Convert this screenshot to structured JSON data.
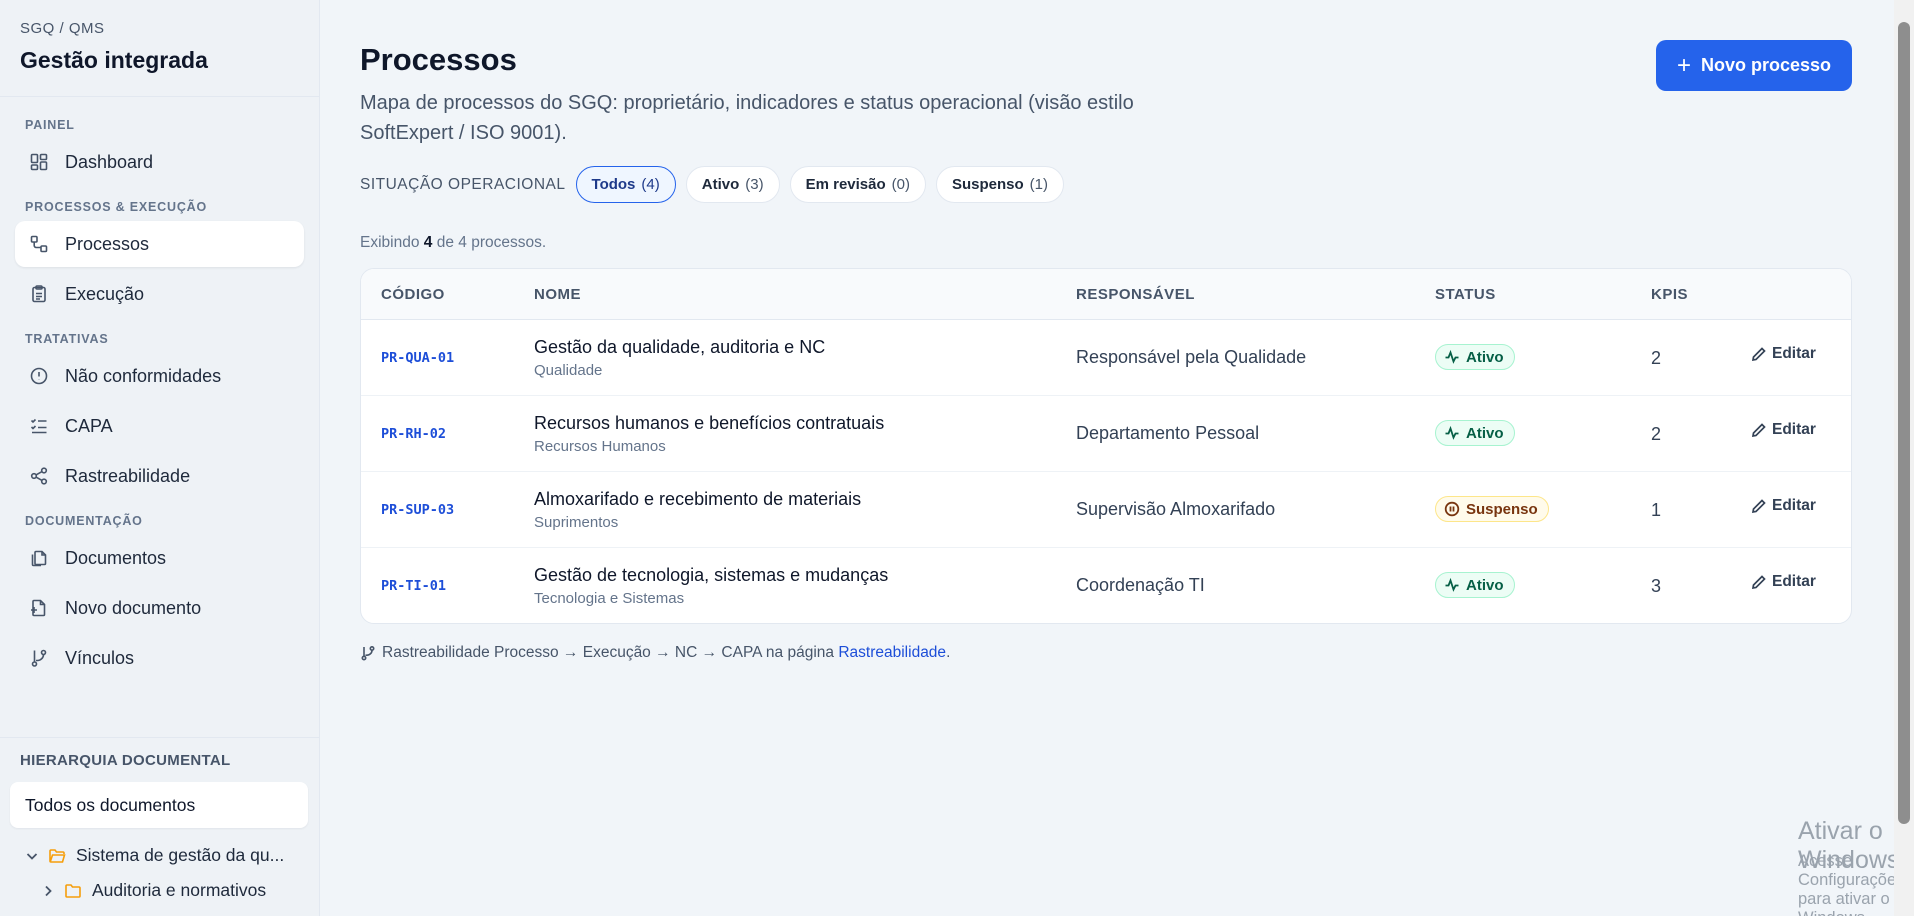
{
  "brand": {
    "subtitle": "SGQ / QMS",
    "title": "Gestão integrada"
  },
  "nav": {
    "sections": {
      "painel": "PAINEL",
      "processos": "PROCESSOS & EXECUÇÃO",
      "tratativas": "TRATATIVAS",
      "documentacao": "DOCUMENTAÇÃO"
    },
    "items": {
      "dashboard": "Dashboard",
      "processos": "Processos",
      "execucao": "Execução",
      "nao_conformidades": "Não conformidades",
      "capa": "CAPA",
      "rastreabilidade": "Rastreabilidade",
      "documentos": "Documentos",
      "novo_documento": "Novo documento",
      "vinculos": "Vínculos"
    }
  },
  "hierarchy": {
    "title": "HIERARQUIA DOCUMENTAL",
    "all": "Todos os documentos",
    "tree": [
      "Sistema de gestão da qu...",
      "Auditoria e normativos"
    ]
  },
  "page": {
    "title": "Processos",
    "description": "Mapa de processos do SGQ: proprietário, indicadores e status operacional (visão estilo SoftExpert / ISO 9001).",
    "new_button": "Novo processo"
  },
  "filters": {
    "label": "SITUAÇÃO OPERACIONAL",
    "chips": [
      {
        "label": "Todos",
        "count": "(4)"
      },
      {
        "label": "Ativo",
        "count": "(3)"
      },
      {
        "label": "Em revisão",
        "count": "(0)"
      },
      {
        "label": "Suspenso",
        "count": "(1)"
      }
    ]
  },
  "showing": {
    "prefix": "Exibindo",
    "count": "4",
    "suffix": "de 4 processos."
  },
  "table": {
    "headers": {
      "code": "CÓDIGO",
      "name": "NOME",
      "resp": "RESPONSÁVEL",
      "status": "STATUS",
      "kpis": "KPIS"
    },
    "edit_label": "Editar",
    "rows": [
      {
        "code": "PR-QUA-01",
        "name": "Gestão da qualidade, auditoria e NC",
        "area": "Qualidade",
        "resp": "Responsável pela Qualidade",
        "status": "Ativo",
        "kpis": "2"
      },
      {
        "code": "PR-RH-02",
        "name": "Recursos humanos e benefícios contratuais",
        "area": "Recursos Humanos",
        "resp": "Departamento Pessoal",
        "status": "Ativo",
        "kpis": "2"
      },
      {
        "code": "PR-SUP-03",
        "name": "Almoxarifado e recebimento de materiais",
        "area": "Suprimentos",
        "resp": "Supervisão Almoxarifado",
        "status": "Suspenso",
        "kpis": "1"
      },
      {
        "code": "PR-TI-01",
        "name": "Gestão de tecnologia, sistemas e mudanças",
        "area": "Tecnologia e Sistemas",
        "resp": "Coordenação TI",
        "status": "Ativo",
        "kpis": "3"
      }
    ]
  },
  "footer": {
    "text": "Rastreabilidade Processo → Execução → NC → CAPA na página",
    "link": "Rastreabilidade",
    "end": "."
  },
  "windows": {
    "title": "Ativar o Windows",
    "subtitle": "Acesse Configurações para ativar o Windows."
  },
  "colors": {
    "accent": "#2563eb",
    "active_badge": "#065f46",
    "suspended_badge": "#78350f"
  }
}
